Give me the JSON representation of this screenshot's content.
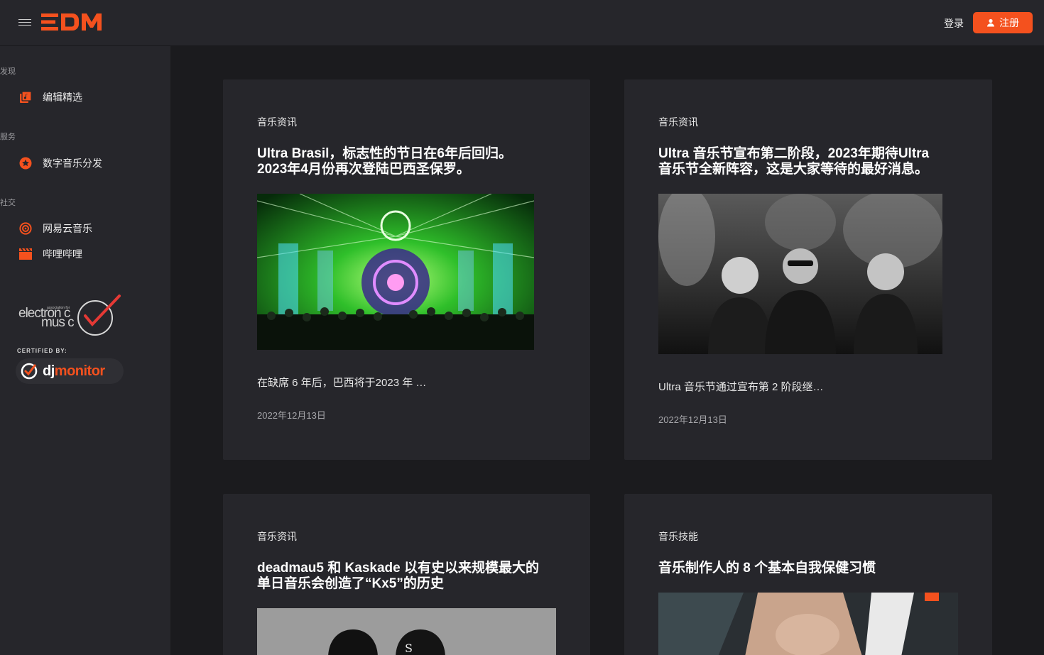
{
  "header": {
    "logo_text": "EDM",
    "brand_color": "#f4511e",
    "login_label": "登录",
    "register_label": "注册"
  },
  "sidebar": {
    "sections": [
      {
        "label": "发现",
        "items": [
          {
            "label": "编辑精选",
            "icon": "editor-picks-icon"
          }
        ]
      },
      {
        "label": "服务",
        "items": [
          {
            "label": "数字音乐分发",
            "icon": "star-badge-icon"
          }
        ]
      },
      {
        "label": "社交",
        "items": [
          {
            "label": "网易云音乐",
            "icon": "netease-music-icon"
          },
          {
            "label": "哔哩哔哩",
            "icon": "bilibili-clapper-icon"
          }
        ]
      }
    ],
    "certified_label": "CERTIFIED BY:",
    "djmonitor_text_a": "dj",
    "djmonitor_text_b": "monitor"
  },
  "cards": [
    {
      "category": "音乐资讯",
      "title_line1": "Ultra Brasil，标志性的节日在6年后回归。",
      "title_line2": "2023年4月份再次登陆巴西圣保罗。",
      "excerpt": "在缺席 6 年后，巴西将于2023 年 …",
      "date": "2022年12月13日"
    },
    {
      "category": "音乐资讯",
      "title_line1": "Ultra 音乐节宣布第二阶段，2023年期待Ultra",
      "title_line2": "音乐节全新阵容，这是大家等待的最好消息。",
      "excerpt": "Ultra 音乐节通过宣布第 2 阶段继…",
      "date": "2022年12月13日"
    },
    {
      "category": "音乐资讯",
      "title_line1": "deadmau5 和 Kaskade 以有史以来规模最大的",
      "title_line2": "单日音乐会创造了“Kx5”的历史"
    },
    {
      "category": "音乐技能",
      "title_line1": "音乐制作人的 8 个基本自我保健习惯"
    }
  ]
}
